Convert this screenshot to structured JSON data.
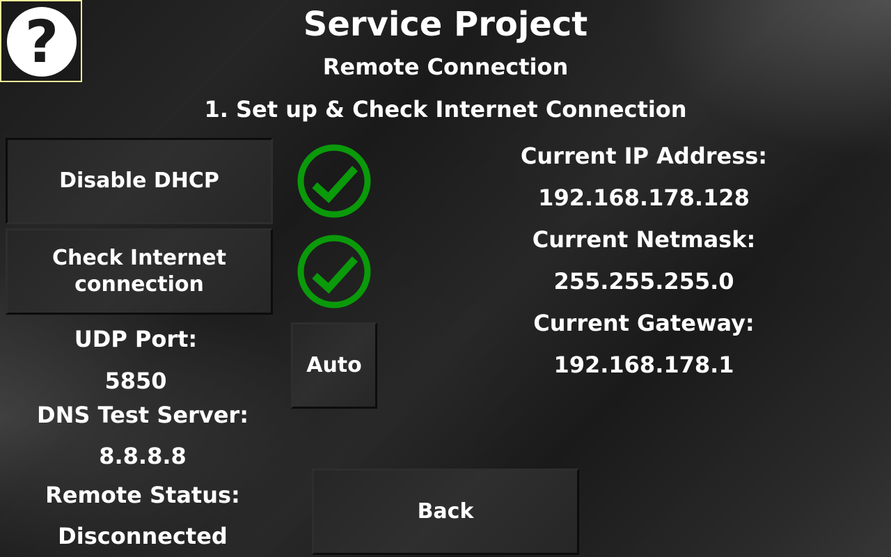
{
  "help": {
    "icon": "question-mark-icon",
    "glyph": "?"
  },
  "header": {
    "title": "Service Project",
    "subtitle": "Remote Connection",
    "step": "1. Set up & Check Internet Connection"
  },
  "buttons": {
    "dhcp_label": "Disable DHCP",
    "check_line1": "Check Internet",
    "check_line2": "connection",
    "auto_label": "Auto",
    "back_label": "Back"
  },
  "status": {
    "dhcp_ok": true,
    "internet_ok": true,
    "ok_color": "#0a9a0a"
  },
  "network": {
    "ip_label": "Current IP Address:",
    "ip_value": "192.168.178.128",
    "netmask_label": "Current Netmask:",
    "netmask_value": "255.255.255.0",
    "gateway_label": "Current Gateway:",
    "gateway_value": "192.168.178.1"
  },
  "settings": {
    "udp_label": "UDP Port:",
    "udp_value": "5850",
    "dns_label": "DNS Test Server:",
    "dns_value": "8.8.8.8",
    "remote_label": "Remote Status:",
    "remote_value": "Disconnected"
  },
  "colors": {
    "help_border": "#f2ec9a",
    "background": "#1a1a1a",
    "text": "#ffffff"
  }
}
